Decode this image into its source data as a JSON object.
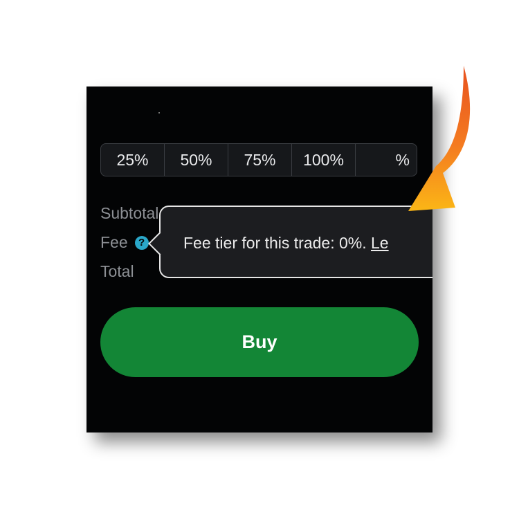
{
  "percent_buttons": [
    "25%",
    "50%",
    "75%",
    "100%"
  ],
  "custom_percent": "%",
  "summary": {
    "subtotal_label": "Subtotal",
    "fee_label": "Fee",
    "total_label": "Total"
  },
  "tooltip": {
    "text": "Fee tier for this trade: 0%.",
    "link": "Le"
  },
  "buy_label": "Buy",
  "colors": {
    "accent_green": "#138636",
    "help_icon": "#2aa7c9",
    "annotation_arrow": "#f47b20"
  },
  "icons": {
    "fee_help": "question-circle-icon",
    "annotation": "curved-arrow-icon"
  }
}
